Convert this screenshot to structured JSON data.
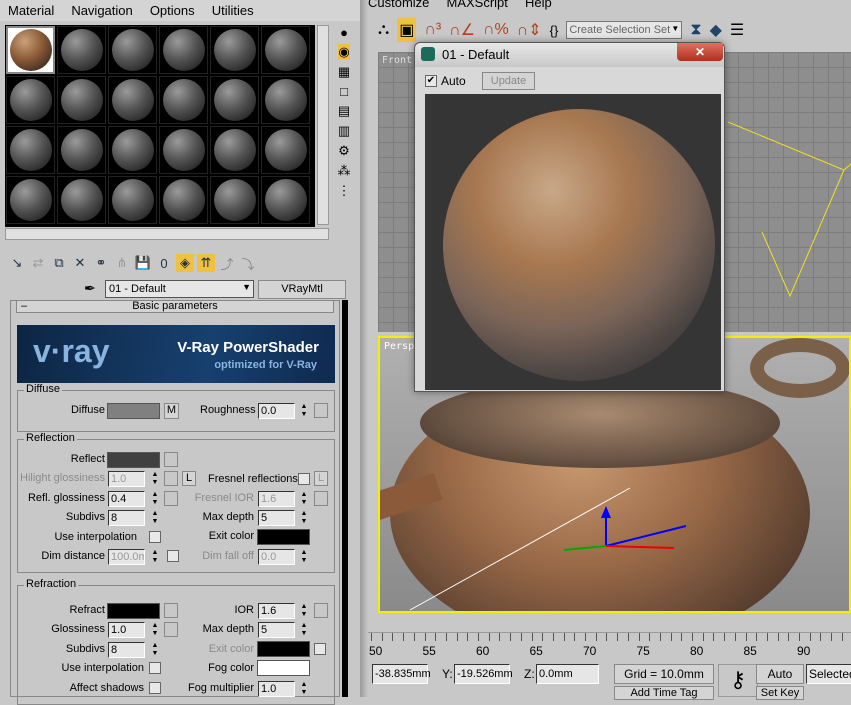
{
  "menu_left": [
    "Material",
    "Navigation",
    "Options",
    "Utilities"
  ],
  "menu_right": [
    "Customize",
    "MAXScript",
    "Help"
  ],
  "material_name": "01 - Default",
  "material_type": "VRayMtl",
  "rollout_title": "Basic parameters",
  "banner": {
    "logo": "v·ray",
    "title": "V-Ray PowerShader",
    "subtitle": "optimized for V-Ray"
  },
  "diffuse": {
    "group": "Diffuse",
    "label": "Diffuse",
    "map_btn": "M",
    "roughness_label": "Roughness",
    "roughness": "0.0",
    "color": "#808080"
  },
  "reflection": {
    "group": "Reflection",
    "reflect_label": "Reflect",
    "reflect_color": "#404040",
    "hilight_label": "Hilight glossiness",
    "hilight": "1.0",
    "lock": "L",
    "fresnel_label": "Fresnel reflections",
    "fresnel_lock": "L",
    "refl_gloss_label": "Refl. glossiness",
    "refl_gloss": "0.4",
    "fresnel_ior_label": "Fresnel IOR",
    "fresnel_ior": "1.6",
    "subdivs_label": "Subdivs",
    "subdivs": "8",
    "max_depth_label": "Max depth",
    "max_depth": "5",
    "use_interp_label": "Use interpolation",
    "exit_color_label": "Exit color",
    "exit_color": "#000000",
    "dim_distance_label": "Dim distance",
    "dim_distance": "100.0m",
    "dim_falloff_label": "Dim fall off",
    "dim_falloff": "0.0"
  },
  "refraction": {
    "group": "Refraction",
    "refract_label": "Refract",
    "refract_color": "#000000",
    "ior_label": "IOR",
    "ior": "1.6",
    "gloss_label": "Glossiness",
    "gloss": "1.0",
    "max_depth_label": "Max depth",
    "max_depth": "5",
    "subdivs_label": "Subdivs",
    "subdivs": "8",
    "exit_color_label": "Exit color",
    "use_interp_label": "Use interpolation",
    "fog_color_label": "Fog color",
    "fog_color": "#ffffff",
    "affect_shadows_label": "Affect shadows",
    "fog_mult_label": "Fog multiplier",
    "fog_mult": "1.0"
  },
  "main_toolbar": {
    "selection_set": "Create Selection Set"
  },
  "preview": {
    "title": "01 - Default",
    "auto_label": "Auto",
    "auto_checked": true,
    "update_label": "Update"
  },
  "viewports": {
    "front": "Front",
    "perspective": "Perspective"
  },
  "timeline": {
    "ticks": [
      "50",
      "55",
      "60",
      "65",
      "70",
      "75",
      "80",
      "85",
      "90"
    ]
  },
  "status": {
    "x": "-38.835mm",
    "y_label": "Y:",
    "y": "-19.526mm",
    "z_label": "Z:",
    "z": "0.0mm",
    "grid": "Grid = 10.0mm",
    "auto_key": "Auto Key",
    "selected": "Selected",
    "set_key": "Set Key",
    "add_time_tag": "Add Time Tag"
  }
}
